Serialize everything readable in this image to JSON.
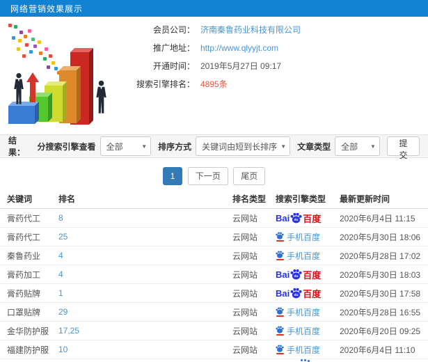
{
  "header": {
    "title": "网络营销效果展示"
  },
  "info": {
    "fields": [
      {
        "label": "会员公司：",
        "value": "济南秦鲁药业科技有限公司"
      },
      {
        "label": "推广地址：",
        "value": "http://www.qlyyjt.com"
      },
      {
        "label": "开通时间：",
        "value": "2019年5月27日 09:17"
      },
      {
        "label": "搜索引擎排名：",
        "value": "4895条"
      }
    ]
  },
  "filters": {
    "result_label": "结果：",
    "engine_label": "分搜索引擎查看",
    "engine_value": "全部",
    "sort_label": "排序方式",
    "sort_value": "关键词由短到长排序",
    "article_label": "文章类型",
    "article_value": "全部",
    "submit_label": "提交"
  },
  "pagination": {
    "current": "1",
    "next": "下一页",
    "last": "尾页"
  },
  "table": {
    "headers": [
      "关键词",
      "排名",
      "排名类型",
      "搜索引擎类型",
      "最新更新时间"
    ],
    "rows": [
      {
        "keyword": "膏药代工",
        "rank": "8",
        "rank_type": "云网站",
        "engine": "pc",
        "updated": "2020年6月4日 11:15"
      },
      {
        "keyword": "膏药代工",
        "rank": "25",
        "rank_type": "云网站",
        "engine": "mobile",
        "updated": "2020年5月30日 18:06"
      },
      {
        "keyword": "秦鲁药业",
        "rank": "4",
        "rank_type": "云网站",
        "engine": "mobile",
        "updated": "2020年5月28日 17:02"
      },
      {
        "keyword": "膏药加工",
        "rank": "4",
        "rank_type": "云网站",
        "engine": "pc",
        "updated": "2020年5月30日 18:03"
      },
      {
        "keyword": "膏药贴牌",
        "rank": "1",
        "rank_type": "云网站",
        "engine": "pc",
        "updated": "2020年5月30日 17:58"
      },
      {
        "keyword": "口罩贴牌",
        "rank": "29",
        "rank_type": "云网站",
        "engine": "mobile",
        "updated": "2020年5月28日 16:55"
      },
      {
        "keyword": "金华防护服",
        "rank": "17,25",
        "rank_type": "云网站",
        "engine": "mobile",
        "updated": "2020年6月20日 09:25"
      },
      {
        "keyword": "福建防护服",
        "rank": "10",
        "rank_type": "云网站",
        "engine": "mobile",
        "updated": "2020年6月4日 11:10"
      }
    ]
  },
  "logos": {
    "baidu_pc": {
      "bai": "Bai",
      "du": "du",
      "cn": "百度"
    },
    "baidu_mobile": {
      "label": "手机百度"
    }
  },
  "colors": {
    "header_bg": "#1181d2",
    "link_blue": "#4596d8",
    "highlight_red": "#e8543c",
    "pagination_active": "#337ab7",
    "baidu_blue": "#2932e1",
    "baidu_red": "#e10b12",
    "mobile_paw_blue": "#2f6fd8"
  }
}
